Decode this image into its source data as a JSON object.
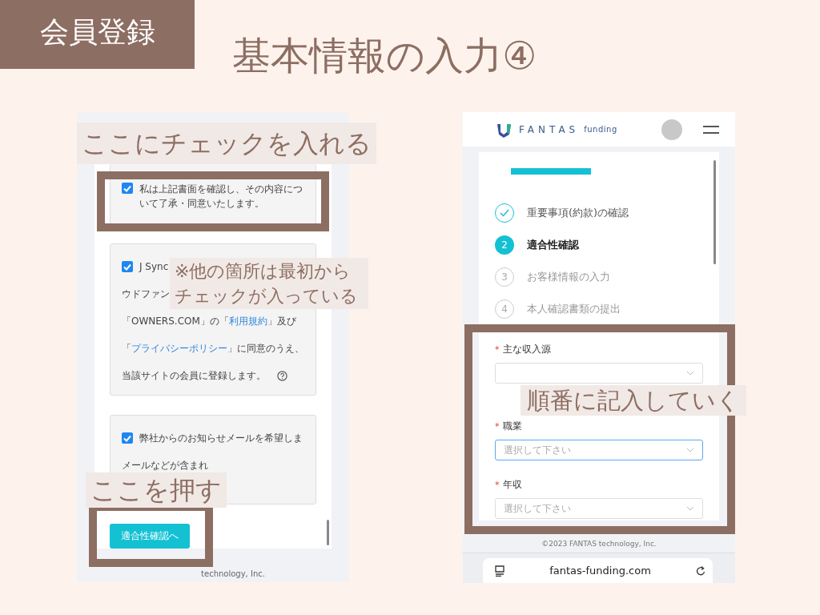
{
  "tag": "会員登録",
  "title": "基本情報の入力④",
  "left_screen": {
    "cards": [
      {
        "checked": true,
        "lines": [
          {
            "text": "私は上記書面を確認し、その内容について了承・同意いたします。"
          }
        ]
      },
      {
        "checked": true,
        "lines": [
          {
            "text": "J Sync"
          },
          {
            "text": "ウドファン"
          },
          {
            "before": "「OWNERS.COM」の「",
            "link": "利用規約",
            "after": "」及び"
          },
          {
            "before": "「",
            "link": "プライバシーポリシー",
            "after": "」に同意のうえ、"
          },
          {
            "text": "当該サイトの会員に登録します。"
          }
        ],
        "help": true
      },
      {
        "checked": true,
        "lines": [
          {
            "text": "弊社からのお知らせメールを希望しま"
          },
          {
            "text": "メールなどが含まれ"
          }
        ]
      }
    ],
    "button": "適合性確認へ",
    "footer": "technology, Inc."
  },
  "right_screen": {
    "logo": {
      "name": "FANTAS",
      "sub": "funding"
    },
    "steps": [
      {
        "completed": true,
        "selected": false,
        "label": "重要事項(約款)の確認"
      },
      {
        "completed": false,
        "selected": true,
        "number": "2",
        "label": "適合性確認"
      },
      {
        "completed": false,
        "selected": false,
        "number": "3",
        "label": "お客様情報の入力"
      },
      {
        "completed": false,
        "selected": false,
        "number": "4",
        "label": "本人確認書類の提出"
      }
    ],
    "fields": [
      {
        "required_mark": "*",
        "label": "主な収入源",
        "focused": false
      },
      {
        "required_mark": "*",
        "label": "職業",
        "placeholder": "選択して下さい",
        "focused": true
      },
      {
        "required_mark": "*",
        "label": "年収",
        "placeholder": "選択して下さい",
        "focused": false
      }
    ],
    "footer": "©2023 FANTAS technology, Inc.",
    "url": "fantas-funding.com"
  },
  "callouts": [
    {
      "text": "ここにチェックを入れる"
    },
    {
      "text": "※他の箇所は最初からチェックが入っている"
    },
    {
      "text": "ここを押す"
    },
    {
      "text": "順番に記入していく"
    }
  ]
}
